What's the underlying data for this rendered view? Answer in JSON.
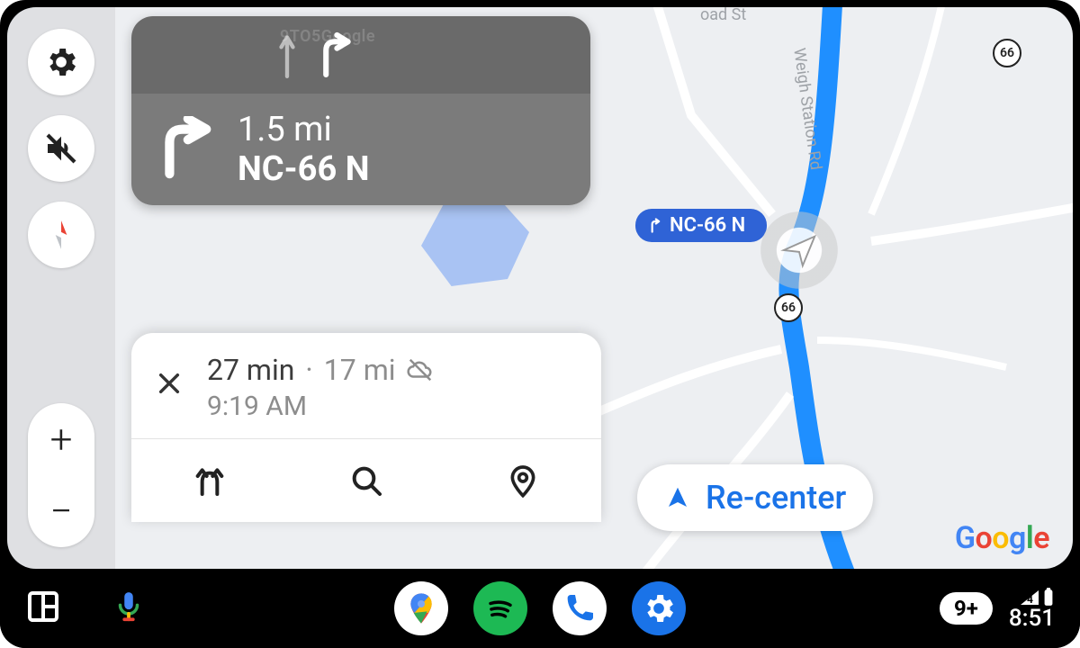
{
  "nav_card": {
    "watermark": "9TO5Google",
    "distance": "1.5 mi",
    "road": "NC-66 N"
  },
  "map": {
    "direction_chip_label": "NC-66 N",
    "shield_a": "66",
    "shield_b": "66",
    "street_weigh": "Weigh Station Rd",
    "street_road": "oad St"
  },
  "trip": {
    "duration": "27 min",
    "separator": "·",
    "distance": "17 mi",
    "eta": "9:19 AM"
  },
  "recenter_label": "Re-center",
  "google_wordmark": {
    "g": "G",
    "o1": "o",
    "o2": "o",
    "g2": "g",
    "l": "l",
    "e": "e"
  },
  "sysbar": {
    "notification_count": "9+",
    "clock": "8:51"
  },
  "rail": {
    "zoom_in": "+",
    "zoom_out": "−"
  }
}
